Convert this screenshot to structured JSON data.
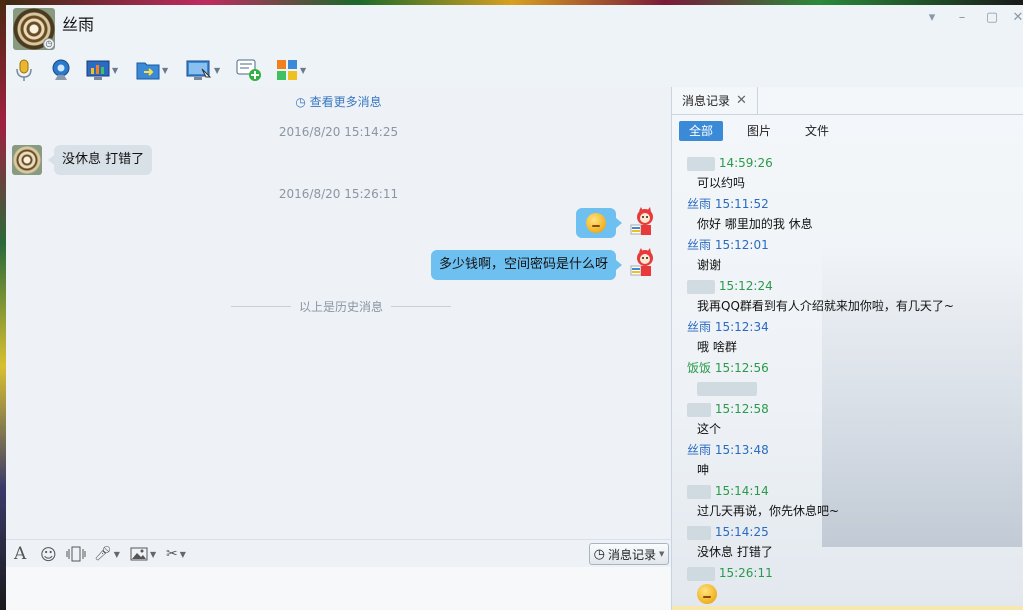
{
  "window": {
    "contact_name": "丝雨",
    "controls": [
      "▾",
      "–",
      "▢",
      "✕"
    ]
  },
  "toolbar": {
    "items": [
      {
        "name": "voice-call-icon",
        "has_menu": false
      },
      {
        "name": "video-call-icon",
        "has_menu": false
      },
      {
        "name": "remote-assist-icon",
        "has_menu": true
      },
      {
        "name": "send-file-icon",
        "has_menu": true
      },
      {
        "name": "screen-share-icon",
        "has_menu": true
      },
      {
        "name": "group-chat-icon",
        "has_menu": false
      },
      {
        "name": "apps-icon",
        "has_menu": true
      }
    ]
  },
  "chat": {
    "more_messages": "查看更多消息",
    "messages": [
      {
        "timestamp": "2016/8/20 15:14:25",
        "direction": "in",
        "text": "没休息 打错了"
      },
      {
        "timestamp": "2016/8/20 15:26:11",
        "direction": "out",
        "emoji": "sleepy-emoji"
      },
      {
        "direction": "out",
        "text": "多少钱啊，空间密码是什么呀"
      }
    ],
    "history_divider": "以上是历史消息"
  },
  "input_bar": {
    "history_button": "消息记录"
  },
  "side_panel": {
    "tab_label": "消息记录",
    "filters": [
      "全部",
      "图片",
      "文件"
    ],
    "active_filter": "全部",
    "entries": [
      {
        "sender": "",
        "time": "14:59:26",
        "color": "green",
        "text": "可以约吗"
      },
      {
        "sender": "丝雨",
        "time": "15:11:52",
        "color": "blue",
        "text": "你好  哪里加的我  休息"
      },
      {
        "sender": "丝雨",
        "time": "15:12:01",
        "color": "blue",
        "text": "谢谢"
      },
      {
        "sender": "",
        "time": "15:12:24",
        "color": "green",
        "text": "我再QQ群看到有人介绍就来加你啦，有几天了~"
      },
      {
        "sender": "丝雨",
        "time": "15:12:34",
        "color": "blue",
        "text": "哦 啥群"
      },
      {
        "sender": "饭饭",
        "time": "15:12:56",
        "color": "green",
        "text": ""
      },
      {
        "sender": "",
        "time": "15:12:58",
        "color": "green",
        "text": "这个"
      },
      {
        "sender": "丝雨",
        "time": "15:13:48",
        "color": "blue",
        "text": "呻"
      },
      {
        "sender": "",
        "time": "15:14:14",
        "color": "green",
        "text": "过几天再说，你先休息吧~"
      },
      {
        "sender": "",
        "time": "15:14:25",
        "color": "blue",
        "text": "没休息 打错了"
      },
      {
        "sender": "",
        "time": "15:26:11",
        "color": "green",
        "text": ""
      }
    ]
  },
  "colors": {
    "accent": "#3a8ad8",
    "outgoing_bubble": "#6ec0f0",
    "incoming_bubble": "#d8e0e8",
    "sender_blue": "#2a6ac0",
    "sender_green": "#2a9a4a"
  }
}
